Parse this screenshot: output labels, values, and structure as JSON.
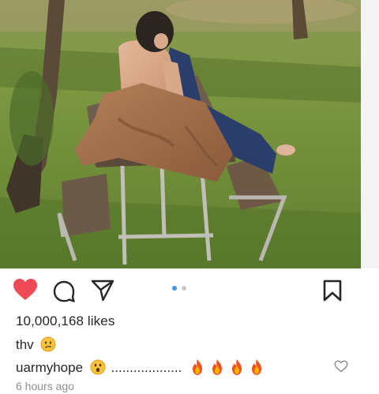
{
  "post": {
    "likes_text": "10,000,168 likes",
    "comments": [
      {
        "username": "thv",
        "emoji": "confused-face-emoji",
        "text": ""
      },
      {
        "username": "uarmyhope",
        "emoji": "astonished-face-emoji",
        "text": "...................",
        "trailing_emojis": [
          "fire-emoji",
          "fire-emoji",
          "fire-emoji",
          "fire-emoji"
        ]
      }
    ],
    "timestamp": "6 hours ago",
    "carousel": {
      "current": 1,
      "total": 2
    },
    "liked": true
  },
  "icons": {
    "like": "heart-icon",
    "comment": "comment-icon",
    "share": "send-icon",
    "save": "bookmark-icon",
    "comment_like": "small-heart-icon"
  },
  "colors": {
    "heart_red": "#ed4956",
    "carousel_active": "#3897f0",
    "carousel_inactive": "#c7c7c7",
    "timestamp_gray": "#8e8e8e",
    "text": "#262626"
  }
}
